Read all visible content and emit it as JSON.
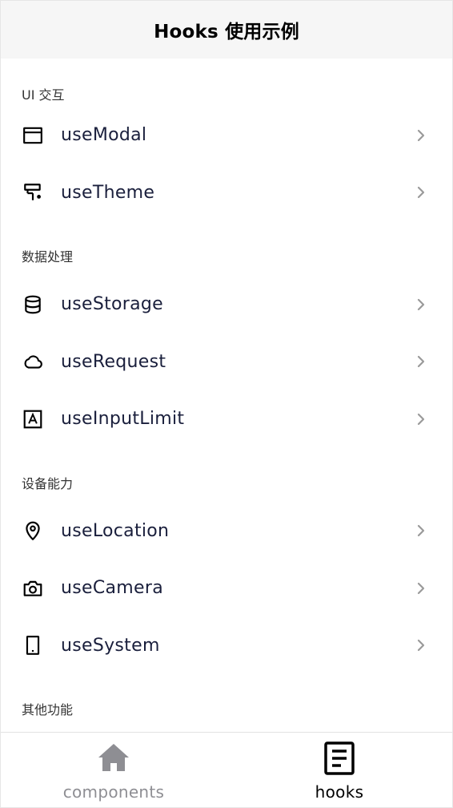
{
  "header": {
    "title": "Hooks 使用示例"
  },
  "sections": [
    {
      "title": "UI 交互",
      "items": [
        {
          "label": "useModal",
          "icon": "window-icon"
        },
        {
          "label": "useTheme",
          "icon": "paint-roller-icon"
        }
      ]
    },
    {
      "title": "数据处理",
      "items": [
        {
          "label": "useStorage",
          "icon": "database-icon"
        },
        {
          "label": "useRequest",
          "icon": "cloud-icon"
        },
        {
          "label": "useInputLimit",
          "icon": "text-box-icon"
        }
      ]
    },
    {
      "title": "设备能力",
      "items": [
        {
          "label": "useLocation",
          "icon": "location-pin-icon"
        },
        {
          "label": "useCamera",
          "icon": "camera-icon"
        },
        {
          "label": "useSystem",
          "icon": "phone-device-icon"
        }
      ]
    },
    {
      "title": "其他功能",
      "items": []
    }
  ],
  "tabbar": {
    "tabs": [
      {
        "label": "components",
        "icon": "home-icon",
        "active": false
      },
      {
        "label": "hooks",
        "icon": "document-icon",
        "active": true
      }
    ]
  },
  "colors": {
    "header_bg": "#f6f6f6",
    "item_text": "#1a1f3c",
    "chevron": "#9a9a9a",
    "tab_inactive": "#8e8e93",
    "tab_active": "#000000"
  }
}
